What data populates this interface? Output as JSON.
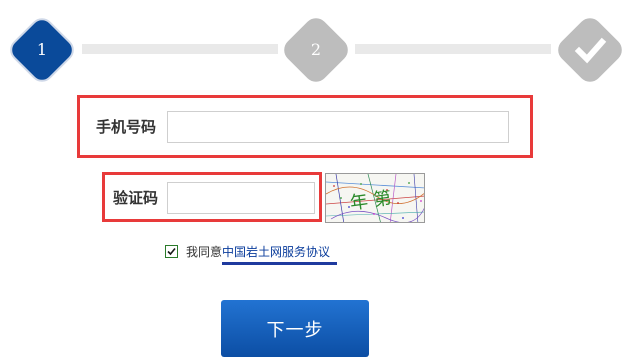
{
  "steps": [
    {
      "label": "1",
      "state": "active"
    },
    {
      "label": "2",
      "state": "pending"
    },
    {
      "icon": "check-icon",
      "state": "pending"
    }
  ],
  "colors": {
    "active_step": "#0a4a9a",
    "pending_step": "#bdbdbd",
    "connector": "#e9e9e9",
    "annotation_red": "#e83a3a",
    "link": "#0b3d9c",
    "button": "#1560c0"
  },
  "form": {
    "phone_label": "手机号码",
    "phone_value": "",
    "code_label": "验证码",
    "code_value": "",
    "captcha_text": "年 第"
  },
  "agreement": {
    "checked": true,
    "text": "我同意",
    "link_text": "中国岩土网服务协议"
  },
  "next_button": {
    "label": "下一步"
  }
}
